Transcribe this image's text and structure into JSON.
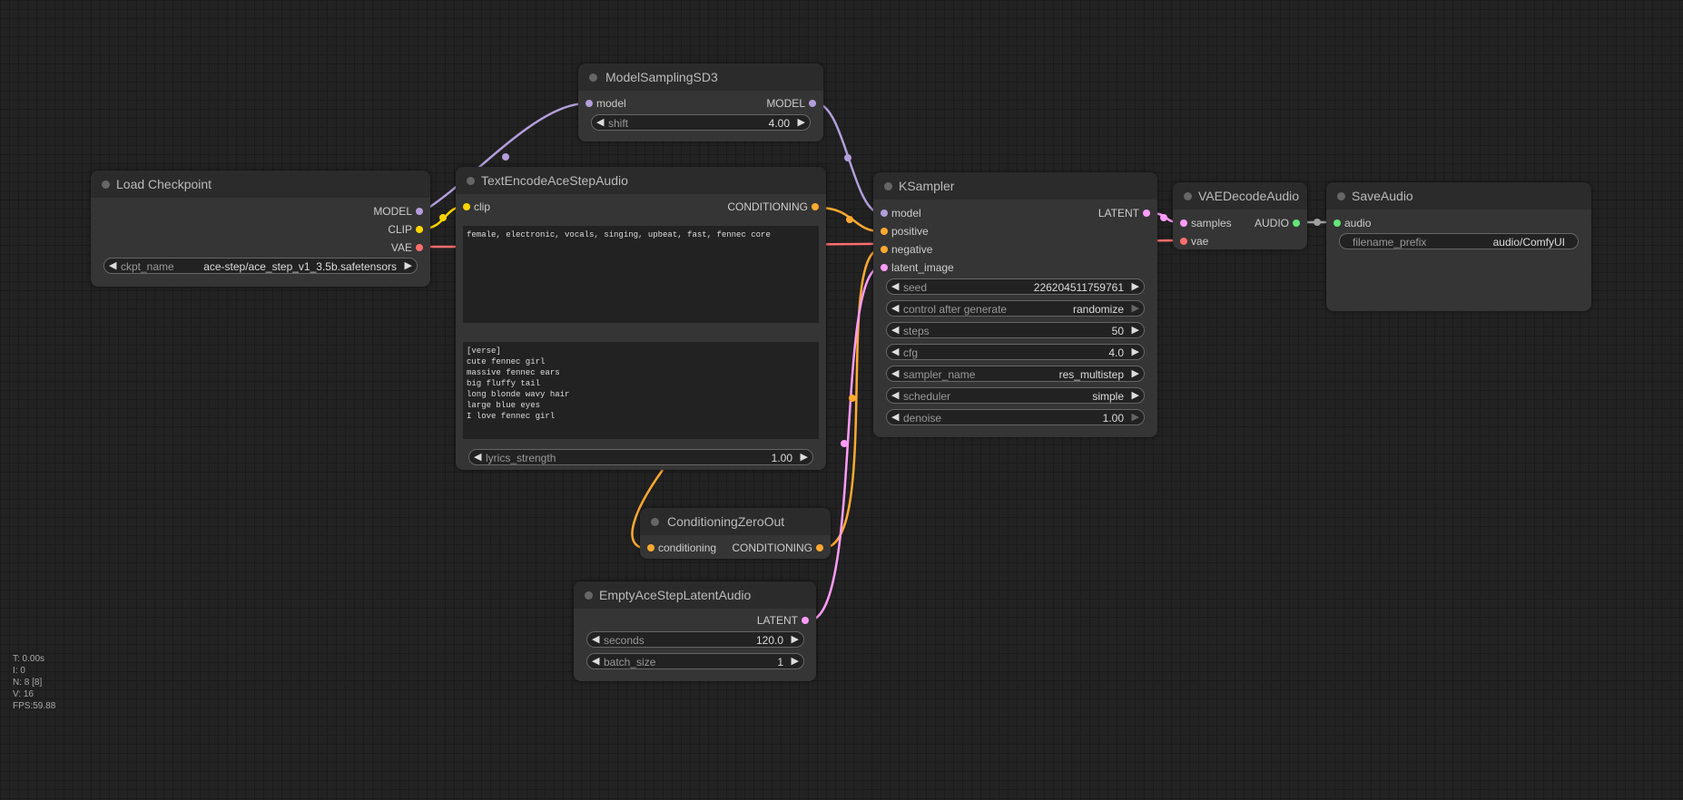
{
  "colors": {
    "model": "#b39ddb",
    "clip": "#ffd500",
    "vae": "#ff6e6e",
    "conditioning": "#ffa931",
    "latent": "#ff9cf9",
    "audio": "#64e47a"
  },
  "nodes": {
    "load_checkpoint": {
      "title": "Load Checkpoint",
      "outputs": [
        "MODEL",
        "CLIP",
        "VAE"
      ],
      "ckpt_name": {
        "name": "ckpt_name",
        "value": "ace-step/ace_step_v1_3.5b.safetensors"
      }
    },
    "model_sampling": {
      "title": "ModelSamplingSD3",
      "input": "model",
      "output": "MODEL",
      "shift": {
        "name": "shift",
        "value": "4.00"
      }
    },
    "text_encode": {
      "title": "TextEncodeAceStepAudio",
      "input": "clip",
      "output": "CONDITIONING",
      "tags": "female, electronic, vocals, singing, upbeat, fast, fennec core",
      "lyrics": "[verse]\ncute fennec girl\nmassive fennec ears\nbig fluffy tail\nlong blonde wavy hair\nlarge blue eyes\nI love fennec girl",
      "lyrics_strength": {
        "name": "lyrics_strength",
        "value": "1.00"
      }
    },
    "ksampler": {
      "title": "KSampler",
      "inputs": [
        "model",
        "positive",
        "negative",
        "latent_image"
      ],
      "output": "LATENT",
      "widgets": [
        {
          "name": "seed",
          "value": "226204511759761"
        },
        {
          "name": "control after generate",
          "value": "randomize"
        },
        {
          "name": "steps",
          "value": "50"
        },
        {
          "name": "cfg",
          "value": "4.0"
        },
        {
          "name": "sampler_name",
          "value": "res_multistep"
        },
        {
          "name": "scheduler",
          "value": "simple"
        },
        {
          "name": "denoise",
          "value": "1.00"
        }
      ]
    },
    "vae_decode": {
      "title": "VAEDecodeAudio",
      "inputs": [
        "samples",
        "vae"
      ],
      "output": "AUDIO"
    },
    "save_audio": {
      "title": "SaveAudio",
      "input": "audio",
      "filename_prefix": {
        "name": "filename_prefix",
        "value": "audio/ComfyUI"
      }
    },
    "cond_zero": {
      "title": "ConditioningZeroOut",
      "input": "conditioning",
      "output": "CONDITIONING"
    },
    "empty_latent": {
      "title": "EmptyAceStepLatentAudio",
      "output": "LATENT",
      "seconds": {
        "name": "seconds",
        "value": "120.0"
      },
      "batch_size": {
        "name": "batch_size",
        "value": "1"
      }
    }
  },
  "stats": {
    "t": "T: 0.00s",
    "i": "I: 0",
    "n": "N: 8 [8]",
    "v": "V: 16",
    "fps": "FPS:59.88"
  }
}
